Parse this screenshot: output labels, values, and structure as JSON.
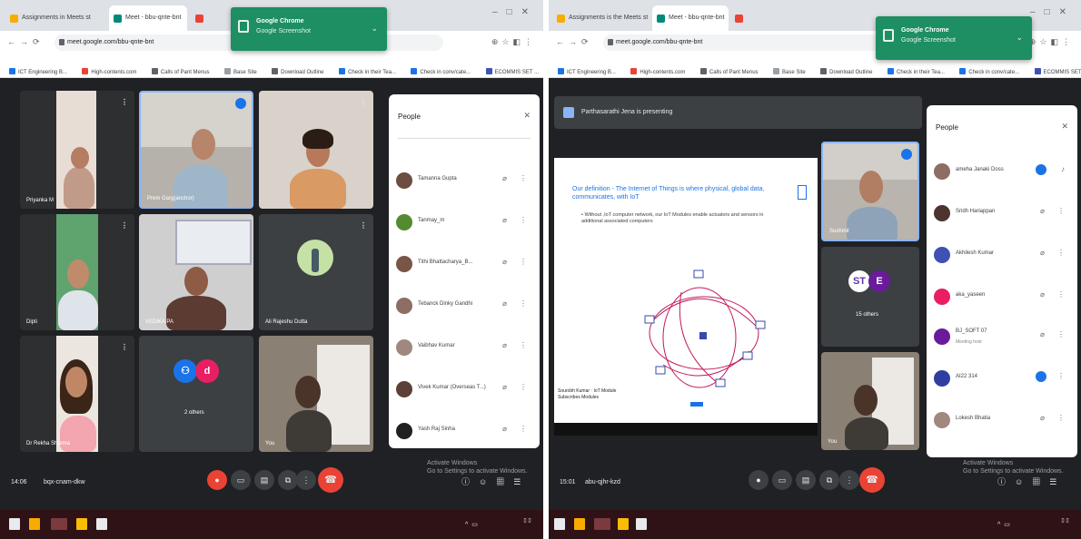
{
  "left": {
    "tabs": [
      {
        "label": "Assignments in Meets st",
        "color": "#f9ab00"
      },
      {
        "label": "Meet - bbu-qnte-bnt",
        "color": "#00897b"
      },
      {
        "label": "",
        "color": "#ea4335"
      }
    ],
    "url": "meet.google.com/bbu-qnte-bnt",
    "bookmarks": [
      {
        "label": "ICT Engineering B...",
        "color": "#1a73e8"
      },
      {
        "label": "High-contents.com",
        "color": "#ea4335"
      },
      {
        "label": "Calls of Pant Menus",
        "color": "#5f6368"
      },
      {
        "label": "Base Site",
        "color": "#9aa0a6"
      },
      {
        "label": "Download Outline",
        "color": "#5f6368"
      },
      {
        "label": "Check in their Tea...",
        "color": "#1a73e8"
      },
      {
        "label": "Check in conv/cate...",
        "color": "#1a73e8"
      },
      {
        "label": "ECOMMIS SET ...",
        "color": "#3f51b5"
      }
    ],
    "toast": {
      "title": "Google Chrome",
      "subtitle": "Google Screenshot"
    },
    "tiles": [
      {
        "name": "Priyanka M",
        "type": "person"
      },
      {
        "name": "Prem Garg(anchor)",
        "type": "person",
        "pinned": true
      },
      {
        "name": "",
        "type": "person"
      },
      {
        "name": "Dipti",
        "type": "person"
      },
      {
        "name": "VEDIKA PA",
        "type": "person"
      },
      {
        "name": "Ali Rajeshu Dutta",
        "type": "avatar"
      },
      {
        "name": "Dr Rekha Sharma",
        "type": "person"
      },
      {
        "name": "2 others",
        "type": "group"
      },
      {
        "name": "You",
        "type": "person"
      }
    ],
    "panel": {
      "title": "People",
      "people": [
        {
          "name": "Tamanna Gupta",
          "color": "#6d4c41"
        },
        {
          "name": "Tanmay_m",
          "color": "#558b2f"
        },
        {
          "name": "Tithi Bhattacharya_B...",
          "color": "#795548"
        },
        {
          "name": "Tebanck Dinky Gandhi",
          "color": "#8d6e63"
        },
        {
          "name": "Vaibhav Kumar",
          "color": "#a1887f"
        },
        {
          "name": "Vivek Kumar (Overseas T...)",
          "color": "#5d4037"
        },
        {
          "name": "Yash Raj Sinha",
          "color": "#212121"
        }
      ]
    },
    "bottom": {
      "time": "14:06",
      "code": "bqx-cnam-dkw",
      "activate": "Activate Windows\nGo to Settings to activate Windows."
    }
  },
  "right": {
    "tabs": [
      {
        "label": "Assignments is the Meets st",
        "color": "#f9ab00"
      },
      {
        "label": "Meet - bbu-qnte-bnt",
        "color": "#00897b"
      },
      {
        "label": "",
        "color": "#ea4335"
      }
    ],
    "url": "meet.google.com/bbu-qnte-bnt",
    "toast": {
      "title": "Google Chrome",
      "subtitle": "Google Screenshot"
    },
    "presenting": "Parthasarathi Jena is presenting",
    "slide": {
      "title": "Our definition - The Internet of Things is where physical, global data, communicates, with IoT",
      "bullet": "• Without ,IoT computer network, our IoT Modules enable actuators and sensors in additional associated computers",
      "footer": "Sourobh Kumar · IoT Module",
      "footer_sub": "Subscribes Modules"
    },
    "tiles": [
      {
        "name": "Sushmit",
        "type": "person",
        "pinned": true
      },
      {
        "name": "15 others",
        "type": "group"
      },
      {
        "name": "You",
        "type": "person"
      }
    ],
    "panel": {
      "title": "People",
      "people": [
        {
          "name": "ameha Janaki Doss",
          "sub": "",
          "color": "#8d6e63",
          "badge": true
        },
        {
          "name": "Sridh Hariappan",
          "sub": "",
          "color": "#4e342e",
          "badge": false
        },
        {
          "name": "Akhilesh Kumar",
          "sub": "",
          "color": "#3f51b5",
          "badge": false
        },
        {
          "name": "aka_yaseen",
          "sub": "",
          "color": "#e91e63",
          "badge": false
        },
        {
          "name": "BJ_SOFT 07",
          "sub": "Meeting host",
          "color": "#6a1b9a",
          "badge": false
        },
        {
          "name": "AI22 314",
          "sub": "",
          "color": "#303f9f",
          "badge": true
        },
        {
          "name": "Lokesh Bhatia",
          "sub": "",
          "color": "#a1887f",
          "badge": false
        }
      ]
    },
    "bottom": {
      "time": "15:01",
      "code": "abu-qjhr-kzd",
      "activate": "Activate Windows\nGo to Settings to activate Windows."
    }
  }
}
